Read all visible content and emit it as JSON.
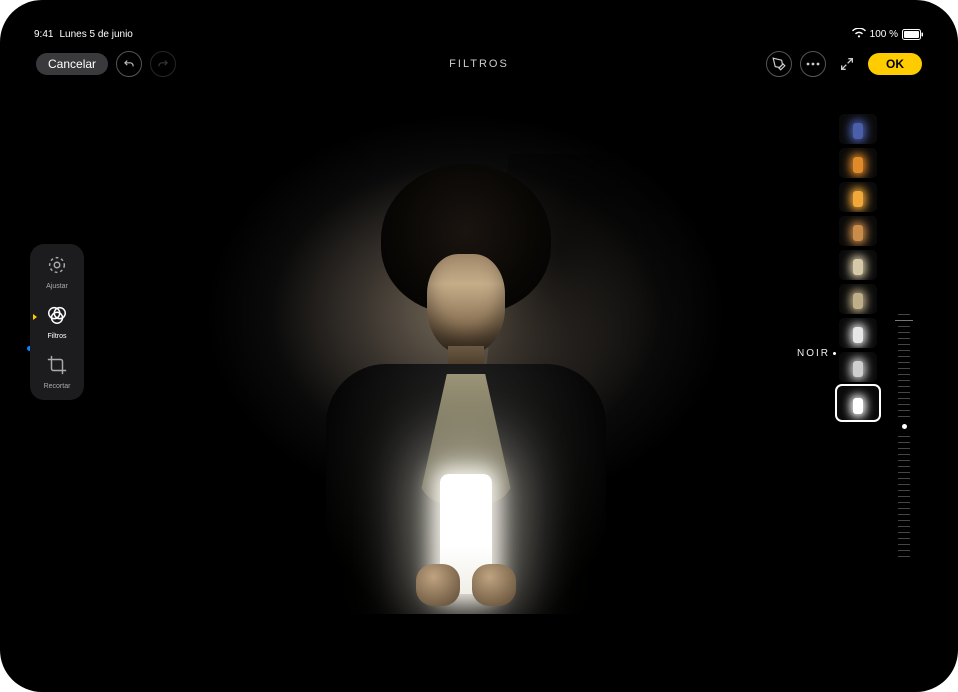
{
  "status": {
    "time": "9:41",
    "date": "Lunes 5 de junio",
    "battery_pct": "100 %"
  },
  "toolbar": {
    "cancel_label": "Cancelar",
    "title": "FILTROS",
    "ok_label": "OK"
  },
  "sidebar": {
    "items": [
      {
        "label": "Ajustar"
      },
      {
        "label": "Filtros"
      },
      {
        "label": "Recortar"
      }
    ],
    "active_index": 1
  },
  "filters": {
    "selected_label": "NOIR",
    "selected_index": 8,
    "thumbs": [
      {
        "tint": "#4a5eaa"
      },
      {
        "tint": "#e08a2a"
      },
      {
        "tint": "#f0a83a"
      },
      {
        "tint": "#c98c4a"
      },
      {
        "tint": "#d6c9a8"
      },
      {
        "tint": "#bfae8a"
      },
      {
        "tint": "#e6e6e6"
      },
      {
        "tint": "#cfcfcf"
      },
      {
        "tint": "#ffffff"
      }
    ]
  }
}
